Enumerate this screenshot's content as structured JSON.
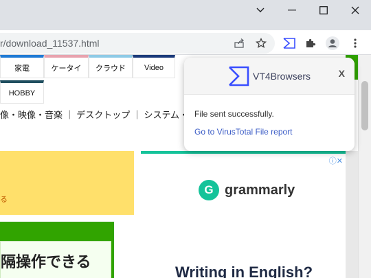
{
  "browser": {
    "url": "r/download_11537.html",
    "window_controls": {
      "dropdown_icon": "chevron-down-icon",
      "minimize_icon": "minimize-icon",
      "maximize_icon": "maximize-icon",
      "close_icon": "close-icon"
    },
    "toolbar_icons": [
      "share-icon",
      "star-icon",
      "virustotal-extension-icon",
      "puzzle-icon",
      "profile-icon",
      "kebab-menu-icon"
    ]
  },
  "page": {
    "tabs": [
      {
        "label": "家電",
        "color": "#1f7ad4"
      },
      {
        "label": "ケータイ",
        "color": "#e8a2ae"
      },
      {
        "label": "クラウド",
        "color": "#8ecae6"
      },
      {
        "label": "Video",
        "color": "#1b3a7a"
      }
    ],
    "tab_row2": [
      {
        "label": "HOBBY",
        "color": "#1f4e5f"
      }
    ],
    "category_nav": "像・映像・音楽 ｜ デスクトップ ｜ システム・",
    "yellow_link": "る",
    "green_banner_text": "隔操作できる",
    "ad": {
      "close_glyphs": "ⓘ✕",
      "logo_letter": "G",
      "brand": "grammarly",
      "headline": "Writing in English?"
    }
  },
  "popup": {
    "title": "VT4Browsers",
    "close_label": "X",
    "message": "File sent successfully.",
    "link": "Go to VirusTotal File report"
  }
}
